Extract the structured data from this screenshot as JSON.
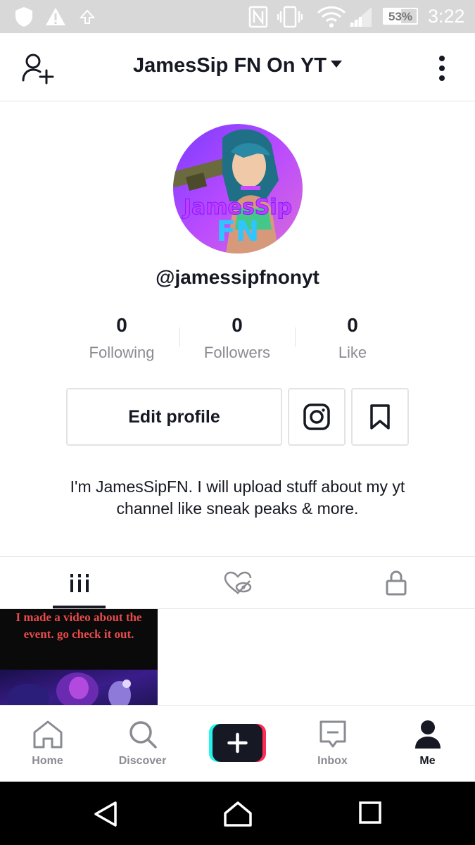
{
  "status_bar": {
    "battery_percent": "53%",
    "battery_level": 0.53,
    "time": "3:22",
    "icons": [
      "shield-icon",
      "warning-icon",
      "upload-arrow-icon",
      "nfc-icon",
      "vibrate-icon",
      "wifi-icon",
      "signal-icon",
      "battery-icon"
    ]
  },
  "header": {
    "title": "JamesSip FN On YT",
    "left_icon": "add-user-icon",
    "right_icon": "more-vertical-icon"
  },
  "profile": {
    "username": "@jamessipfnonyt",
    "avatar_text_line1": "JamesSip",
    "avatar_text_line2": "FN",
    "stats": [
      {
        "value": "0",
        "label": "Following"
      },
      {
        "value": "0",
        "label": "Followers"
      },
      {
        "value": "0",
        "label": "Like"
      }
    ],
    "edit_button_label": "Edit profile",
    "bio": "I'm JamesSipFN. I will upload stuff about my yt channel like sneak peaks & more."
  },
  "tabs": [
    {
      "icon": "videos-grid-icon",
      "selected": true
    },
    {
      "icon": "liked-hidden-icon",
      "selected": false
    },
    {
      "icon": "lock-icon",
      "selected": false
    }
  ],
  "videos": [
    {
      "caption": "I made a video about the event. go check it out."
    }
  ],
  "bottom_nav": [
    {
      "label": "Home",
      "icon": "home-icon"
    },
    {
      "label": "Discover",
      "icon": "search-icon"
    },
    {
      "label": "",
      "icon": "create-plus-icon"
    },
    {
      "label": "Inbox",
      "icon": "inbox-icon"
    },
    {
      "label": "Me",
      "icon": "profile-icon",
      "active": true
    }
  ],
  "colors": {
    "accent_cyan": "#25f4ee",
    "accent_red": "#fe2c55",
    "text_primary": "#161823",
    "text_secondary": "#8a8b91",
    "border": "#e3e3e4"
  }
}
